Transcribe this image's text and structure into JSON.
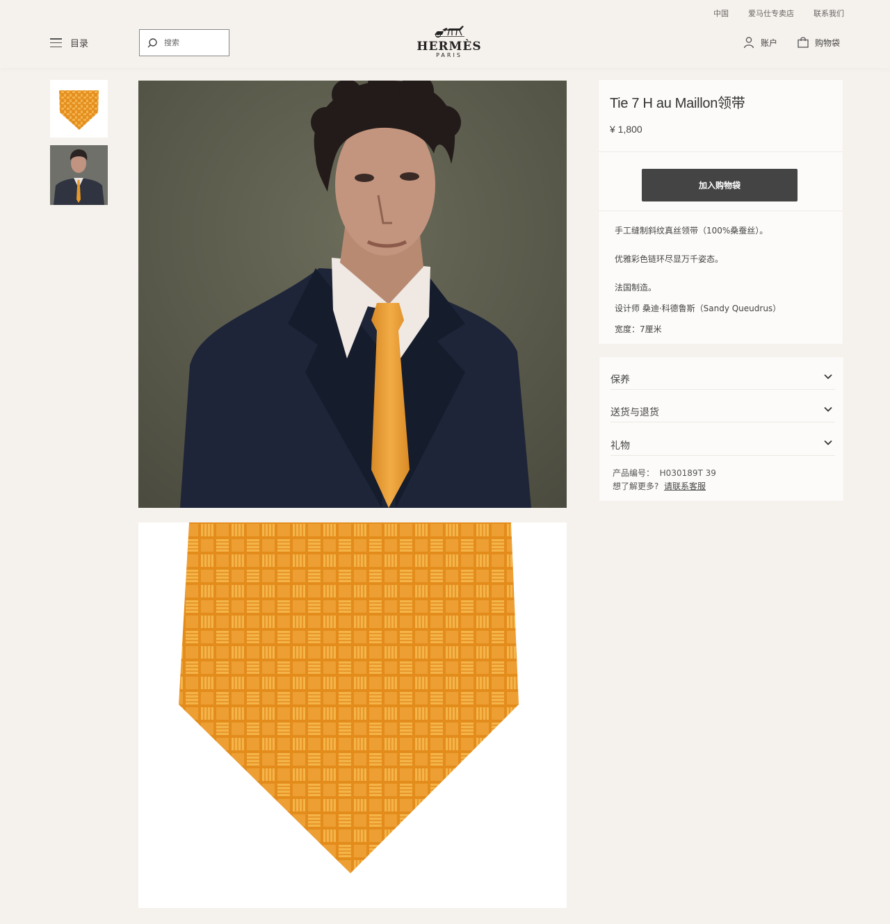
{
  "topbar": {
    "links": [
      "中国",
      "爱马仕专卖店",
      "联系我们"
    ]
  },
  "header": {
    "menu_label": "目录",
    "search_placeholder": "搜索",
    "logo_word": "HERMÈS",
    "logo_sub": "PARIS",
    "account_label": "账户",
    "bag_label": "购物袋"
  },
  "product": {
    "title": "Tie 7 H au Maillon领带",
    "price": "¥ 1,800",
    "add_to_bag": "加入购物袋",
    "description": [
      "手工缝制斜纹真丝领带（100%桑蚕丝）。",
      "优雅彩色链环尽显万千姿态。",
      "法国制造。",
      "设计师 桑迪·科德鲁斯（Sandy Queudrus）",
      "宽度：7厘米"
    ]
  },
  "accordion": {
    "items": [
      "保养",
      "送货与退货",
      "礼物"
    ]
  },
  "meta": {
    "ref_label": "产品编号：",
    "ref_value": "H030189T 39",
    "more_label": "想了解更多?",
    "more_link": "请联系客服"
  },
  "colors": {
    "tie_orange": "#e89a2a",
    "button": "#444444",
    "background": "#f5f1ec"
  }
}
